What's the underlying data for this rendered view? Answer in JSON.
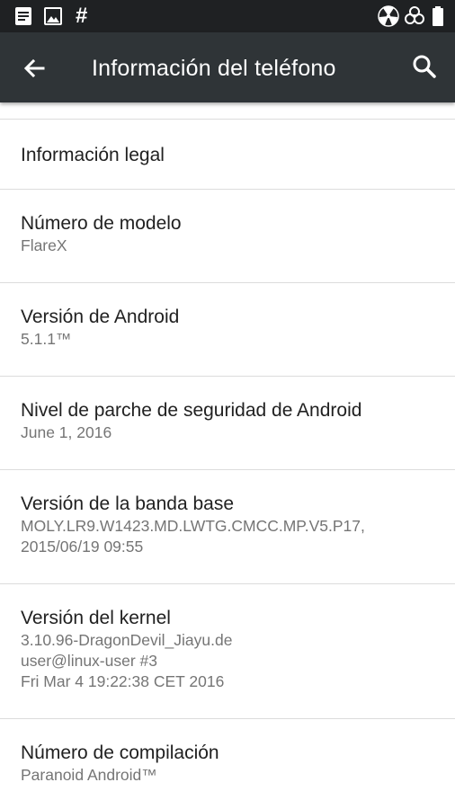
{
  "status_bar": {
    "left_icons": [
      "notes-icon",
      "image-icon",
      "hash-icon"
    ],
    "hash_text": "#",
    "right_icons": [
      "radiation-icon",
      "biohazard-icon",
      "battery-full-icon"
    ]
  },
  "toolbar": {
    "title": "Información del teléfono",
    "back_icon": "arrow-back-icon",
    "search_icon": "search-icon"
  },
  "items": [
    {
      "title": "Información legal"
    },
    {
      "title": "Número de modelo",
      "subtitle": [
        "FlareX"
      ]
    },
    {
      "title": "Versión de Android",
      "subtitle": [
        "5.1.1™"
      ]
    },
    {
      "title": "Nivel de parche de seguridad de Android",
      "subtitle": [
        "June 1, 2016"
      ]
    },
    {
      "title": "Versión de la banda base",
      "subtitle": [
        "MOLY.LR9.W1423.MD.LWTG.CMCC.MP.V5.P17,",
        "2015/06/19 09:55"
      ]
    },
    {
      "title": "Versión del kernel",
      "subtitle": [
        "3.10.96-DragonDevil_Jiayu.de",
        "user@linux-user #3",
        "Fri Mar 4 19:22:38 CET 2016"
      ]
    },
    {
      "title": "Número de compilación",
      "subtitle": [
        "Paranoid Android™"
      ]
    }
  ],
  "colors": {
    "status_bar_bg": "#1f2123",
    "toolbar_bg": "#2f3437",
    "primary_text": "#212121",
    "secondary_text": "#757575",
    "divider": "#dcdcdc"
  }
}
